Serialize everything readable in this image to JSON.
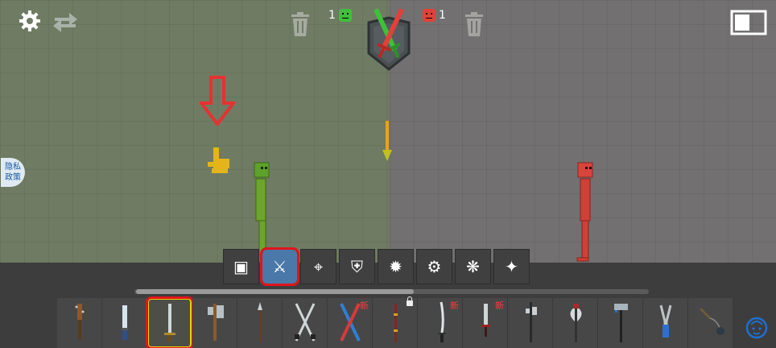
{
  "colors": {
    "team_green": "#3fbf3a",
    "team_red": "#e2413a",
    "highlight_red": "#e0141c",
    "tutorial_arrow": "#e53232",
    "pointer_yellow": "#e3b51a"
  },
  "score": {
    "green_count": "1",
    "red_count": "1"
  },
  "icons": {
    "settings": "gear-icon",
    "swap": "swap-icon",
    "trash": "trash-icon",
    "window": "window-toggle-icon",
    "crest": "crossed-swords-crest",
    "hint_arrow": "down-arrow-icon",
    "hand": "tap-hand-icon"
  },
  "privacy": {
    "line1": "隐私",
    "line2": "政策"
  },
  "categories": [
    {
      "name": "vehicles",
      "icon": "vehicle-icon",
      "glyph": "▣"
    },
    {
      "name": "weapons",
      "icon": "sword-icon",
      "glyph": "⚔"
    },
    {
      "name": "firearms",
      "icon": "crosshair-icon",
      "glyph": "⌖"
    },
    {
      "name": "armor",
      "icon": "armor-icon",
      "glyph": "⛨"
    },
    {
      "name": "explosives",
      "icon": "bomb-icon",
      "glyph": "✹"
    },
    {
      "name": "machines",
      "icon": "machine-icon",
      "glyph": "⚙"
    },
    {
      "name": "animals",
      "icon": "paw-icon",
      "glyph": "❋"
    },
    {
      "name": "magic",
      "icon": "wand-icon",
      "glyph": "✦"
    }
  ],
  "active_category": "weapons",
  "scroll_progress": 0.54,
  "items": [
    {
      "name": "spiked-club",
      "badge": ""
    },
    {
      "name": "knife",
      "badge": ""
    },
    {
      "name": "sword",
      "badge": "",
      "selected": true
    },
    {
      "name": "axe",
      "badge": ""
    },
    {
      "name": "spear",
      "badge": ""
    },
    {
      "name": "twin-swords",
      "badge": ""
    },
    {
      "name": "crossed-blades",
      "badge": "新"
    },
    {
      "name": "staff",
      "badge": "",
      "locked": true
    },
    {
      "name": "katana",
      "badge": "新"
    },
    {
      "name": "dagger",
      "badge": "新"
    },
    {
      "name": "halberd",
      "badge": ""
    },
    {
      "name": "battle-axe",
      "badge": ""
    },
    {
      "name": "war-hammer",
      "badge": ""
    },
    {
      "name": "pliers",
      "badge": ""
    },
    {
      "name": "flail",
      "badge": ""
    }
  ],
  "help_icon": "assistant-face-icon"
}
